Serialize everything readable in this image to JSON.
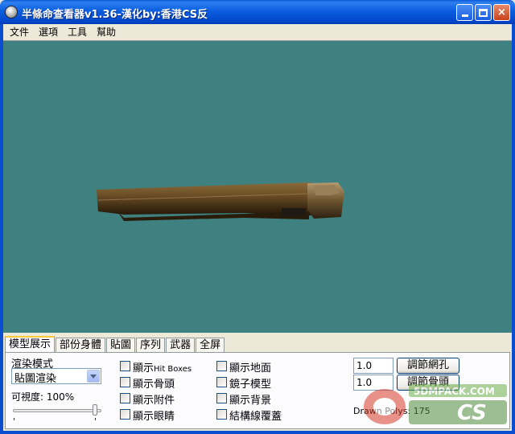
{
  "window": {
    "title": "半條命查看器v1.36-漢化by:香港CS反",
    "minimize_label": "",
    "maximize_label": "",
    "close_label": "×"
  },
  "menu": [
    "文件",
    "選項",
    "工具",
    "幫助"
  ],
  "viewport": {
    "background": "#3f8080"
  },
  "tabs": [
    "模型展示",
    "部份身體",
    "貼圖",
    "序列",
    "武器",
    "全屏"
  ],
  "active_tab": 0,
  "panel": {
    "render_mode_label": "渲染模式",
    "render_mode_value": "貼圖渲染",
    "visibility_label": "可視度: 100%",
    "visibility_value": 100,
    "checkboxes_col1": [
      {
        "label": "顯示",
        "suffix": "Hit Boxes",
        "checked": false
      },
      {
        "label": "顯示骨頭",
        "suffix": "",
        "checked": false
      },
      {
        "label": "顯示附件",
        "suffix": "",
        "checked": false
      },
      {
        "label": "顯示眼睛",
        "suffix": "",
        "checked": false
      }
    ],
    "checkboxes_col2": [
      {
        "label": "顯示地面",
        "checked": false
      },
      {
        "label": "鏡子模型",
        "checked": false
      },
      {
        "label": "顯示背景",
        "checked": false
      },
      {
        "label": "結構線覆蓋",
        "checked": false
      }
    ],
    "mesh_value": "1.0",
    "mesh_button": "調節網孔",
    "bone_value": "1.0",
    "bone_button": "調節骨頭",
    "drawn_polys": "Drawn Polys: 175"
  },
  "watermark": {
    "text": "5DMPACK.COM",
    "brand": "CS"
  }
}
